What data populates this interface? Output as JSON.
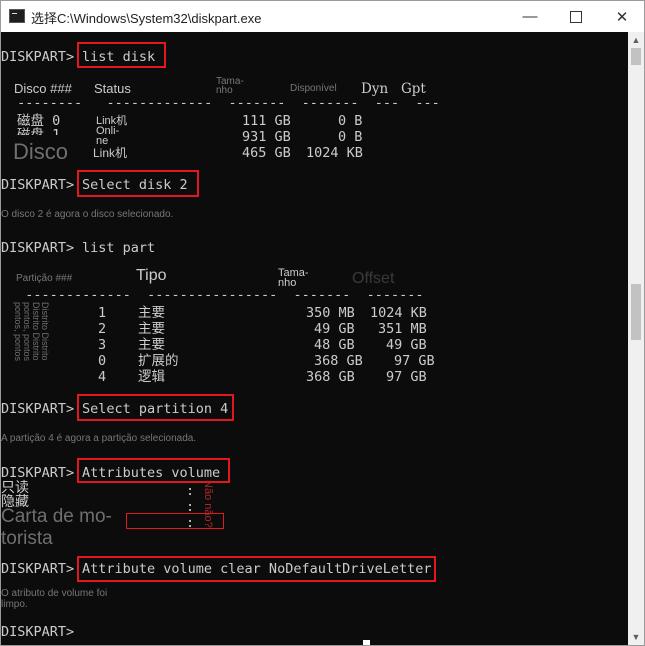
{
  "window": {
    "title": "选择C:\\Windows\\System32\\diskpart.exe",
    "minimize_glyph": "—",
    "close_glyph": "✕"
  },
  "console": {
    "cmd1_prompt": "DISKPART>",
    "cmd1": "list disk",
    "disk_headers": {
      "disco": "Disco ###",
      "status": "Status",
      "tamanho": "Tama-\nnho",
      "disponivel": "Disponível",
      "dyn": "Dyn",
      "gpt": "Gpt"
    },
    "disk_separator": " --------   -------------  -------  -------  ---  ---",
    "disk_rows": [
      {
        "name": "磁盘 0",
        "status": "Link机",
        "size": "111 GB",
        "free": "0 B"
      },
      {
        "name": "磁盘 1",
        "status": "Onli-\nne",
        "size": "931 GB",
        "free": "0 B"
      },
      {
        "name": "Disco",
        "status": "Link机",
        "size": "465 GB",
        "free": "1024 KB"
      }
    ],
    "cmd2_prompt": "DISKPART>",
    "cmd2": "Select disk 2",
    "msg2": "O disco 2 é agora o disco selecionado.",
    "cmd3_prompt": "DISKPART>",
    "cmd3": "list part",
    "part_headers": {
      "particao": "Partição ###",
      "tipo": "Tipo",
      "tamanho": "Tama-\nnho",
      "offset": "Offset"
    },
    "part_separator": "  -------------  ----------------  -------  -------",
    "part_side_label": "Distrito Distrito\nDistrito Distrito\npontos, pontos\npontos, pontos",
    "part_rows": [
      {
        "num": "1",
        "type": "主要",
        "size": "350 MB",
        "offset": "1024 KB"
      },
      {
        "num": "2",
        "type": "主要",
        "size": "49 GB",
        "offset": "351 MB"
      },
      {
        "num": "3",
        "type": "主要",
        "size": "48 GB",
        "offset": "49 GB"
      },
      {
        "num": "0",
        "type": "扩展的",
        "size": "368 GB",
        "offset": "97 GB"
      },
      {
        "num": "4",
        "type": "逻辑",
        "size": "368 GB",
        "offset": "97 GB"
      }
    ],
    "cmd4_prompt": "DISKPART>",
    "cmd4": "Select partition 4",
    "msg4": "A partição 4 é agora a partição selecionada.",
    "cmd5_prompt": "DISKPART>",
    "cmd5": "Attributes volume",
    "attr_rows": [
      "只读",
      "隐藏",
      "Carta de mo-\ntorista"
    ],
    "attr_colon": ":",
    "attr_values": "Não não?",
    "cmd6_prompt": "DISKPART>",
    "cmd6": "Attribute volume clear NoDefaultDriveLetter",
    "msg6": "O atributo de volume foi\nlimpo.",
    "final_prompt": "DISKPART>"
  },
  "scrollbar": {
    "up_glyph": "▲",
    "down_glyph": "▼",
    "position": 0.45
  }
}
